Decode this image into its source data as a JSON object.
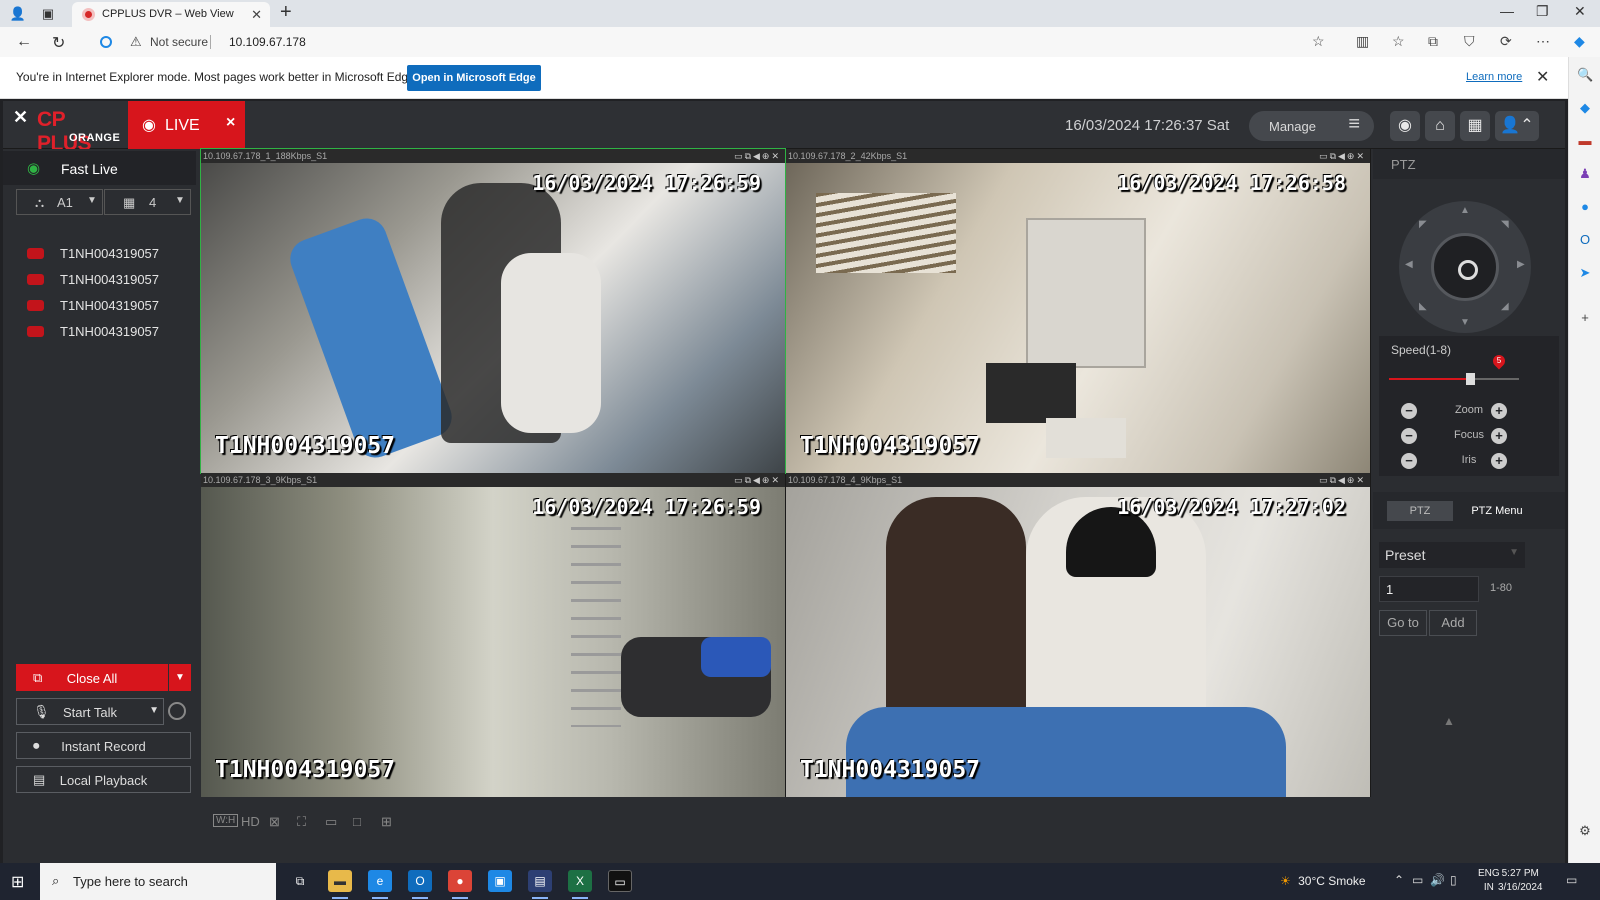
{
  "browser": {
    "tab_title": "CPPLUS DVR – Web View",
    "security_text": "Not secure",
    "url": "10.109.67.178",
    "ie_message": "You're in Internet Explorer mode. Most pages work better in Microsoft Edge.",
    "ie_button": "Open in Microsoft Edge",
    "learn_more": "Learn more"
  },
  "app": {
    "logo_brand": "CP PLUS",
    "logo_sub": "ORANGE",
    "live_label": "LIVE",
    "datetime": "16/03/2024 17:26:37 Sat",
    "manage_label": "Manage"
  },
  "left": {
    "fast_live": "Fast Live",
    "stream_select": "A1",
    "layout_select": "4",
    "cameras": [
      {
        "label": "T1NH004319057"
      },
      {
        "label": "T1NH004319057"
      },
      {
        "label": "T1NH004319057"
      },
      {
        "label": "T1NH004319057"
      }
    ],
    "close_all": "Close All",
    "start_talk": "Start Talk",
    "instant_record": "Instant Record",
    "local_playback": "Local Playback"
  },
  "grid": {
    "cells": [
      {
        "header": "10.109.67.178_1_188Kbps_S1",
        "timestamp": "16/03/2024 17:26:59",
        "name": "T1NH004319057"
      },
      {
        "header": "10.109.67.178_2_42Kbps_S1",
        "timestamp": "16/03/2024 17:26:58",
        "name": "T1NH004319057"
      },
      {
        "header": "10.109.67.178_3_9Kbps_S1",
        "timestamp": "16/03/2024 17:26:59",
        "name": "T1NH004319057"
      },
      {
        "header": "10.109.67.178_4_9Kbps_S1",
        "timestamp": "16/03/2024 17:27:02",
        "name": "T1NH004319057"
      }
    ],
    "toolbar_hd": "HD"
  },
  "ptz": {
    "title": "PTZ",
    "speed_label": "Speed(1-8)",
    "speed_value": 5,
    "speed_max": 8,
    "zoom_label": "Zoom",
    "focus_label": "Focus",
    "iris_label": "Iris",
    "tab_ptz": "PTZ",
    "tab_menu": "PTZ Menu",
    "preset_label": "Preset",
    "preset_value": "1",
    "preset_range": "1-80",
    "goto_label": "Go to",
    "add_label": "Add"
  },
  "taskbar": {
    "search_placeholder": "Type here to search",
    "weather": "30°C  Smoke",
    "lang1": "ENG",
    "lang2": "IN",
    "time": "5:27 PM",
    "date": "3/16/2024"
  },
  "colors": {
    "accent": "#d7151c",
    "active_green": "#2fb344",
    "edge_blue": "#0f6cbd"
  }
}
